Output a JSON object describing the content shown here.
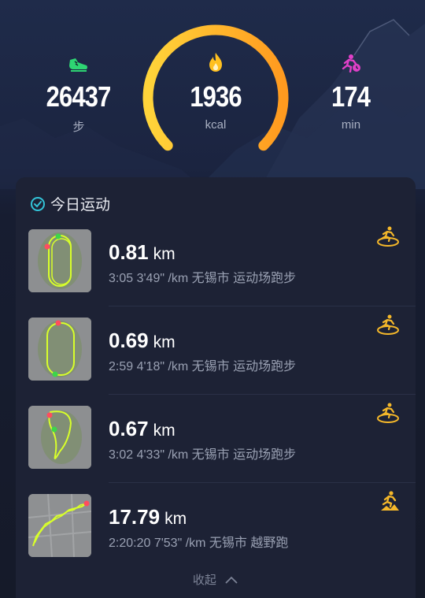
{
  "stats": {
    "steps": {
      "value": "26437",
      "unit": "步",
      "icon": "shoe-icon",
      "color": "#2ed573"
    },
    "calories": {
      "value": "1936",
      "unit": "kcal",
      "icon": "flame-icon",
      "color": "#ffc020"
    },
    "minutes": {
      "value": "174",
      "unit": "min",
      "icon": "running-clock-icon",
      "color": "#e040c8"
    }
  },
  "gauge": {
    "progress": 1.0,
    "colors": [
      "#ffcc33",
      "#ff9a1f"
    ]
  },
  "today": {
    "title": "今日运动",
    "icon": "check-circle-icon",
    "activities": [
      {
        "distance": "0.81",
        "unit": "km",
        "meta": "3:05  3'49\" /km 无锡市 运动场跑步",
        "type_icon": "track-run-icon"
      },
      {
        "distance": "0.69",
        "unit": "km",
        "meta": "2:59  4'18\" /km 无锡市 运动场跑步",
        "type_icon": "track-run-icon"
      },
      {
        "distance": "0.67",
        "unit": "km",
        "meta": "3:02  4'33\" /km 无锡市 运动场跑步",
        "type_icon": "track-run-icon"
      },
      {
        "distance": "17.79",
        "unit": "km",
        "meta": "2:20:20  7'53\" /km 无锡市 越野跑",
        "type_icon": "trail-run-icon"
      }
    ],
    "collapse_label": "收起"
  },
  "accent": "#f5b82a"
}
